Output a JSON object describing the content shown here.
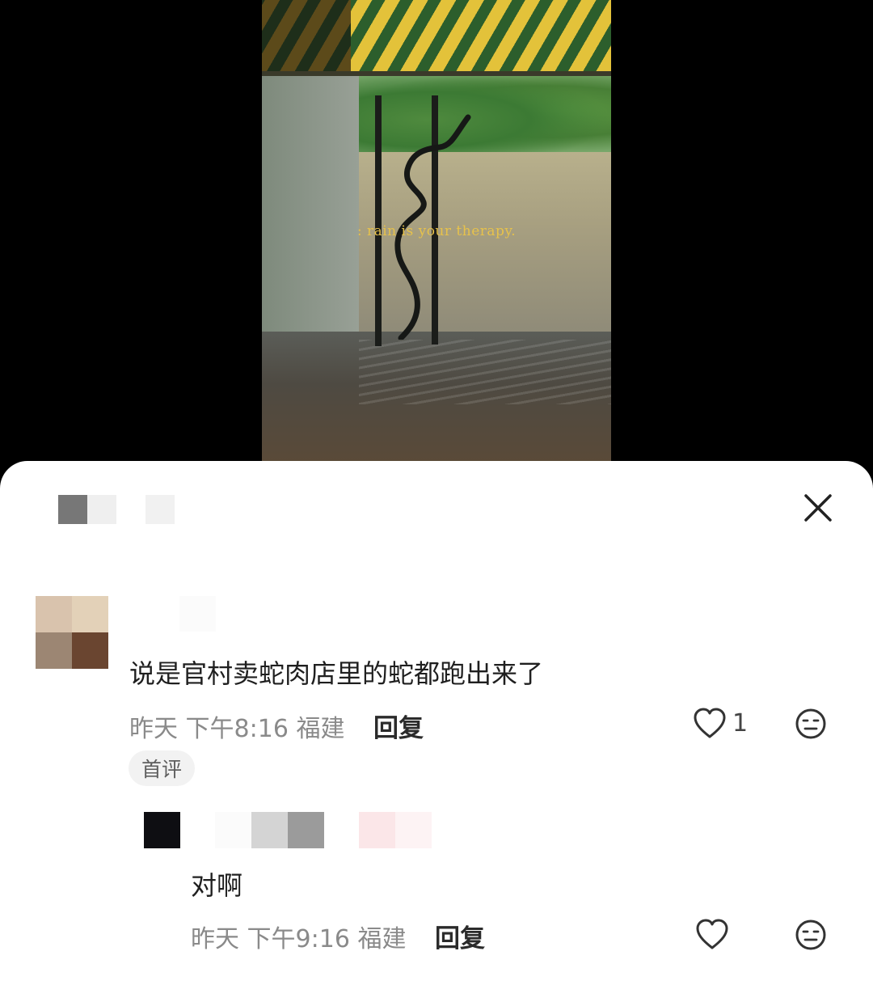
{
  "video": {
    "overlay_caption": ": rain is your therapy."
  },
  "comments_panel": {
    "close_icon": "close-icon"
  },
  "comment": {
    "text": "说是官村卖蛇肉店里的蛇都跑出来了",
    "time_label": "昨天 下午8:16 福建",
    "reply_label": "回复",
    "like_count": "1",
    "badge": "首评",
    "reply": {
      "text": "对啊",
      "time_label": "昨天 下午9:16 福建",
      "reply_label": "回复"
    }
  },
  "colors": {
    "overlay_text": "#e7c24b",
    "meta_text": "#8a8a8a"
  }
}
